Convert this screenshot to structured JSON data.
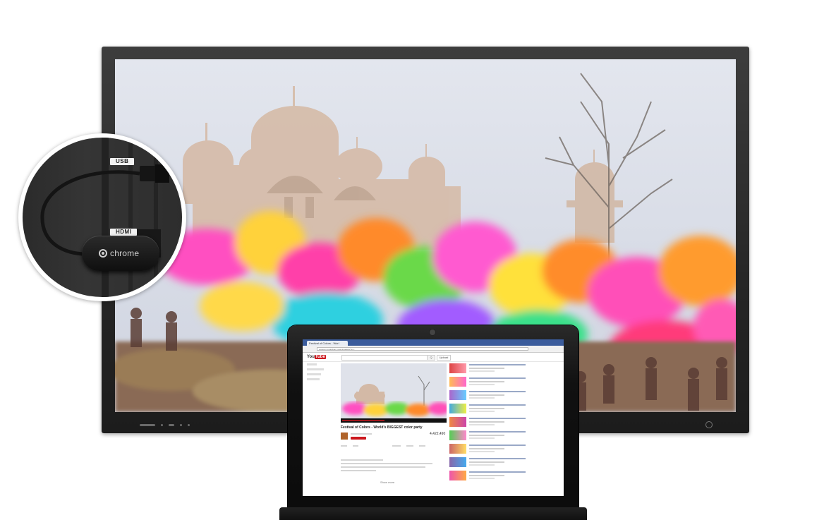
{
  "tv": {
    "scene": "holi-festival-color-powder-crowd",
    "colors": {
      "frame": "#2a2a2a",
      "sky": "#d9dde8",
      "palace": "#d3b8a6"
    }
  },
  "inset": {
    "usb_label": "USB",
    "hdmi_label": "HDMI",
    "dongle_brand": "chrome"
  },
  "laptop": {
    "browser": {
      "tab_title": "Festival of Colors - Worl",
      "url": "www.youtube.com/watch?v=..."
    },
    "youtube": {
      "logo_you": "You",
      "logo_tube": "Tube",
      "search_button": "Q",
      "upload_label": "Upload",
      "video_title": "Festival of Colors - World's BIGGEST color party",
      "view_count": "4,422,490",
      "show_more": "Show more"
    }
  },
  "colors": {
    "youtube_red": "#cc181e",
    "chrome_tab_blue": "#3b5c9c"
  }
}
